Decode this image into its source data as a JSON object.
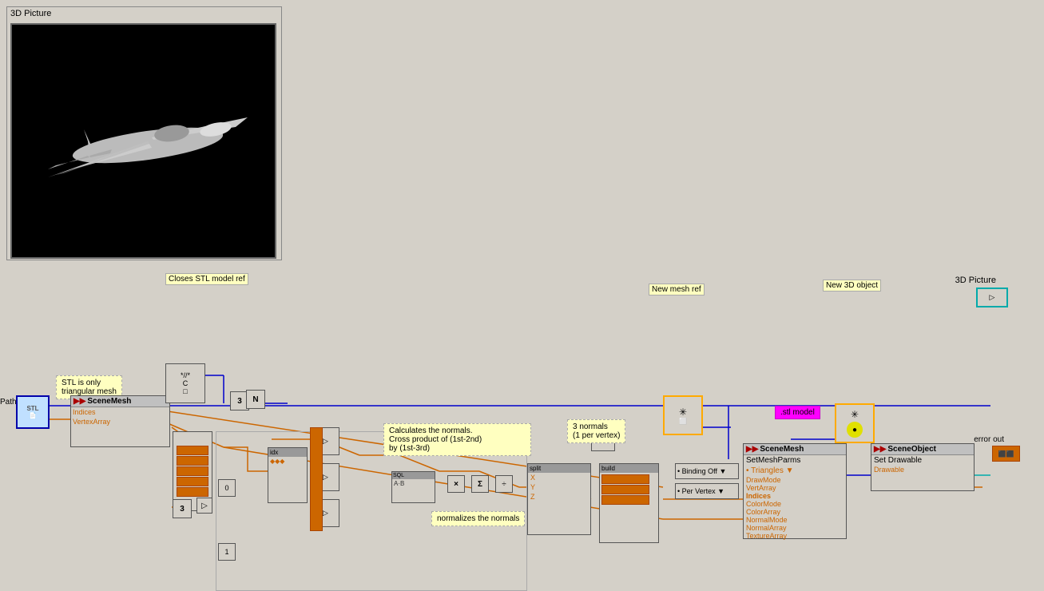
{
  "picture_panel": {
    "title": "3D Picture"
  },
  "labels": {
    "closes_stl": "Closes STL model ref",
    "new_mesh_ref": "New mesh ref",
    "new_3d_object": "New 3D object",
    "stl_only_triangular": "STL is only\ntriangular mesh",
    "calculates_normals": "Calculates the normals.\nCross product of (1st-2nd)\nby (1st-3rd)",
    "normalizes_normals": "normalizes the normals",
    "three_normals": "3 normals\n(1 per vertex)",
    "path_label": "Path",
    "error_out_label": "error out",
    "stl_model_label": ".stl model",
    "picture_3d_label": "3D Picture"
  },
  "nodes": {
    "scene_mesh_1": {
      "header": "SceneMesh",
      "ports": [
        "Indices",
        "VertexArray"
      ]
    },
    "scene_mesh_2": {
      "header": "SceneMesh",
      "sub": "SetMeshParms"
    },
    "scene_object": {
      "header": "SceneObject",
      "sub": "Set Drawable",
      "ports": [
        "Drawable"
      ]
    },
    "dropdown_1": {
      "items": [
        "Triangles ▼",
        "DrawMode",
        "VertArray",
        "Indices",
        "ColorMode",
        "ColorArray",
        "NormalMode",
        "NormalArray",
        "TextureArray"
      ]
    },
    "dropdown_2": {
      "items": [
        "Binding Off ▼",
        "Per Vertex ▼"
      ]
    }
  },
  "colors": {
    "orange": "#cc6600",
    "blue": "#0000cc",
    "cyan": "#00aaaa",
    "magenta": "#ff00ff",
    "yellow_bg": "#ffffc0",
    "wire_orange": "#cc6600",
    "wire_blue": "#0000cc",
    "wire_cyan": "#00cccc"
  }
}
